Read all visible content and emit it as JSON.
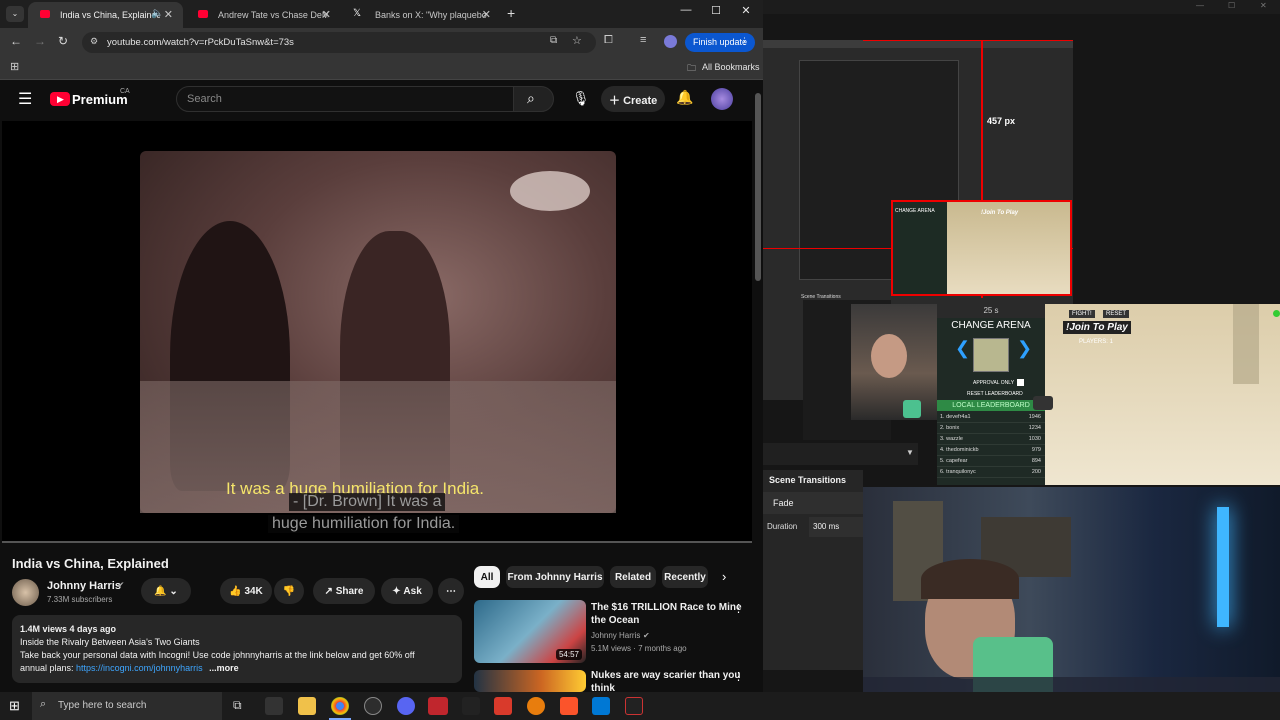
{
  "tabs": [
    {
      "title": "India vs China, Explained - Yo",
      "active": true
    },
    {
      "title": "Andrew Tate vs Chase DeMoor",
      "active": false
    },
    {
      "title": "Banks on X: \"Why plaqueboyma",
      "active": false
    }
  ],
  "omnibar": {
    "url": "youtube.com/watch?v=rPckDuTaSnw&t=73s",
    "finish_update": "Finish update"
  },
  "bookmarks": {
    "all_bookmarks": "All Bookmarks"
  },
  "youtube": {
    "logo_text": "Premium",
    "region": "CA",
    "search_placeholder": "Search",
    "create_label": "Create"
  },
  "video": {
    "burned_caption": "It was a huge humiliation for India.",
    "cc_line1": "- [Dr. Brown] It was a",
    "cc_line2": "huge humiliation for India."
  },
  "meta": {
    "title": "India vs China, Explained",
    "channel": "Johnny Harris",
    "subscribers": "7.33M subscribers",
    "likes": "34K",
    "share": "Share",
    "ask": "Ask"
  },
  "description": {
    "stats": "1.4M views  4 days ago",
    "line1": "Inside the Rivalry Between Asia's Two Giants",
    "line2": "Take back your personal data with Incogni! Use code johnnyharris at the link below and get 60% off",
    "line3_prefix": "annual plans: ",
    "link": "https://incogni.com/johnnyharris",
    "more": "...more"
  },
  "chips": [
    "All",
    "From Johnny Harris",
    "Related",
    "Recently"
  ],
  "recommendations": [
    {
      "title_l1": "The $16 TRILLION Race to Mine",
      "title_l2": "the Ocean",
      "channel": "Johnny Harris",
      "stats": "5.1M views · 7 months ago",
      "duration": "54:57"
    },
    {
      "title_l1": "Nukes are way scarier than you",
      "title_l2": "think",
      "channel": "",
      "stats": "",
      "duration": ""
    }
  ],
  "obs": {
    "measure": "457 px",
    "scene_transitions": "Scene Transitions",
    "fade": "Fade",
    "duration_label": "Duration",
    "duration_value": "300 ms"
  },
  "game": {
    "timer": "25 s",
    "fight": "FIGHT!",
    "reset": "RESET",
    "join": "!Join To Play",
    "players": "PLAYERS: 1",
    "change_arena": "CHANGE ARENA",
    "approval": "APPROVAL ONLY",
    "reset_lb": "RESET LEADERBOARD",
    "local_lb": "LOCAL LEADERBOARD",
    "leaderboard": [
      {
        "name": "1. devefr4a1",
        "score": "1946"
      },
      {
        "name": "2. bonix",
        "score": "1234"
      },
      {
        "name": "3. wazzle",
        "score": "1030"
      },
      {
        "name": "4. thedominickb",
        "score": "979"
      },
      {
        "name": "5. capefear",
        "score": "894"
      },
      {
        "name": "6. tranquilonyc",
        "score": "200"
      }
    ]
  },
  "taskbar": {
    "search_placeholder": "Type here to search"
  }
}
